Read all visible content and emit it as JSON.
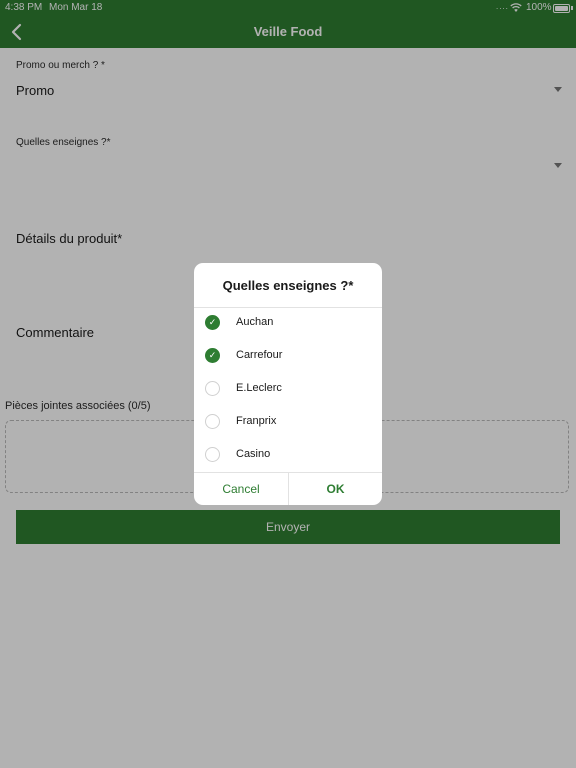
{
  "status_bar": {
    "time": "4:38 PM",
    "date": "Mon Mar 18",
    "battery": "100%"
  },
  "nav": {
    "title": "Veille Food",
    "back_icon": "chevron-left-icon"
  },
  "form": {
    "promo_label": "Promo ou merch ? *",
    "promo_value": "Promo",
    "enseignes_label": "Quelles enseignes ?*",
    "details_label": "Détails du produit*",
    "comment_label": "Commentaire",
    "attachments_label": "Pièces jointes associées (0/5)",
    "submit_label": "Envoyer"
  },
  "dialog": {
    "title": "Quelles enseignes ?*",
    "options": [
      {
        "label": "Auchan",
        "selected": true
      },
      {
        "label": "Carrefour",
        "selected": true
      },
      {
        "label": "E.Leclerc",
        "selected": false
      },
      {
        "label": "Franprix",
        "selected": false
      },
      {
        "label": "Casino",
        "selected": false
      }
    ],
    "cancel_label": "Cancel",
    "ok_label": "OK"
  },
  "colors": {
    "accent": "#2e7d32",
    "overlay": "rgba(0,0,0,0.30)"
  }
}
